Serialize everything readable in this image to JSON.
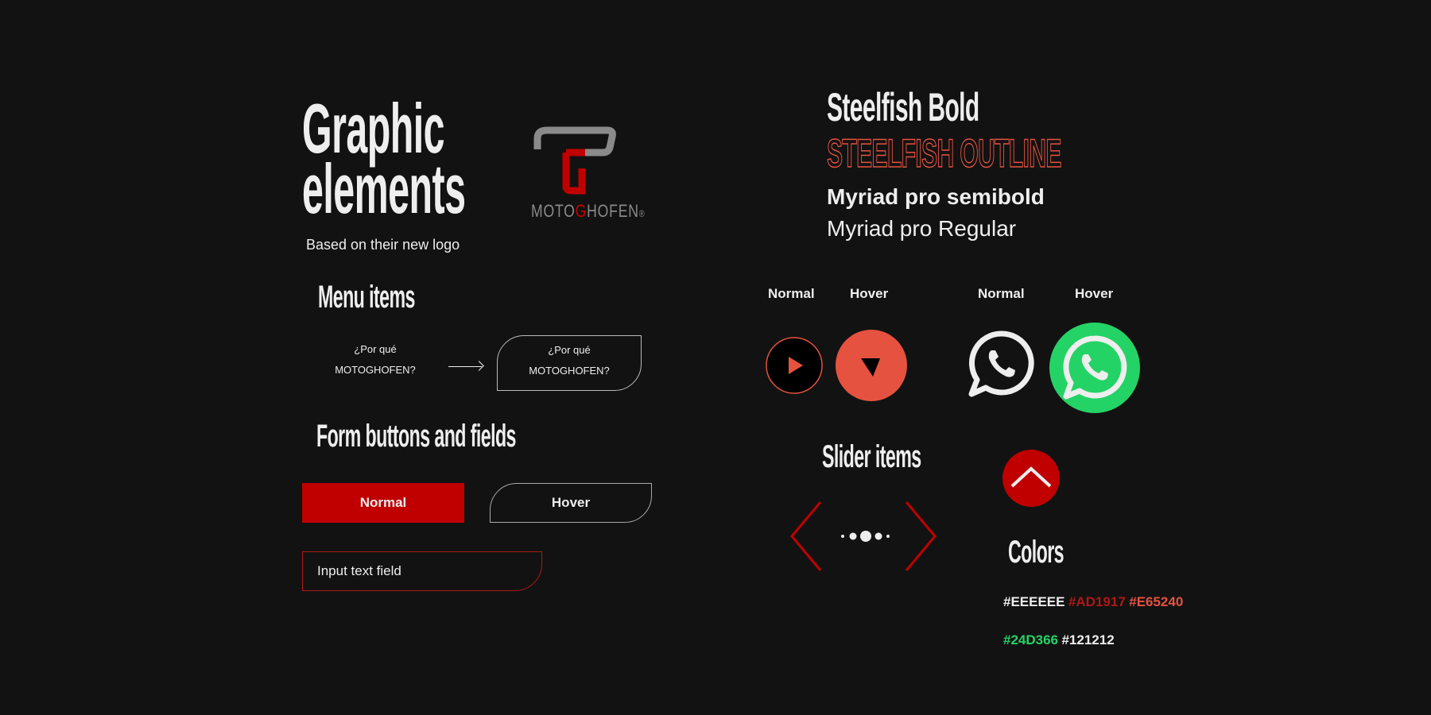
{
  "header": {
    "title_line1": "Graphic",
    "title_line2": "elements",
    "subtitle": "Based on their new logo"
  },
  "logo": {
    "text_prefix": "MOTO",
    "text_accent": "G",
    "text_suffix": "HOFEN",
    "registered": "®"
  },
  "typography": {
    "samples": [
      {
        "label": "Steelfish Bold"
      },
      {
        "label": "STEELFISH OUTLINE"
      },
      {
        "label": "Myriad pro semibold"
      },
      {
        "label": "Myriad pro Regular"
      }
    ]
  },
  "menu": {
    "heading": "Menu items",
    "normal": {
      "line1": "¿Por qué",
      "line2": "MOTOGHOFEN?"
    },
    "hover": {
      "line1": "¿Por qué",
      "line2": "MOTOGHOFEN?"
    }
  },
  "form": {
    "heading": "Form buttons and fields",
    "normal_button": "Normal",
    "hover_button": "Hover",
    "input_placeholder": "Input text  field"
  },
  "icon_states": {
    "play": {
      "normal_label": "Normal",
      "hover_label": "Hover"
    },
    "whatsapp": {
      "normal_label": "Normal",
      "hover_label": "Hover"
    }
  },
  "slider": {
    "heading": "Slider items",
    "dots": 5,
    "active_dot": 3
  },
  "colors": {
    "heading": "Colors",
    "palette": [
      {
        "hex": "#EEEEEE",
        "label": "#EEEEEE"
      },
      {
        "hex": "#AD1917",
        "label": "#AD1917"
      },
      {
        "hex": "#E65240",
        "label": "#E65240"
      },
      {
        "hex": "#24D366",
        "label": "#24D366"
      },
      {
        "hex": "#121212",
        "label": "#121212"
      }
    ]
  }
}
